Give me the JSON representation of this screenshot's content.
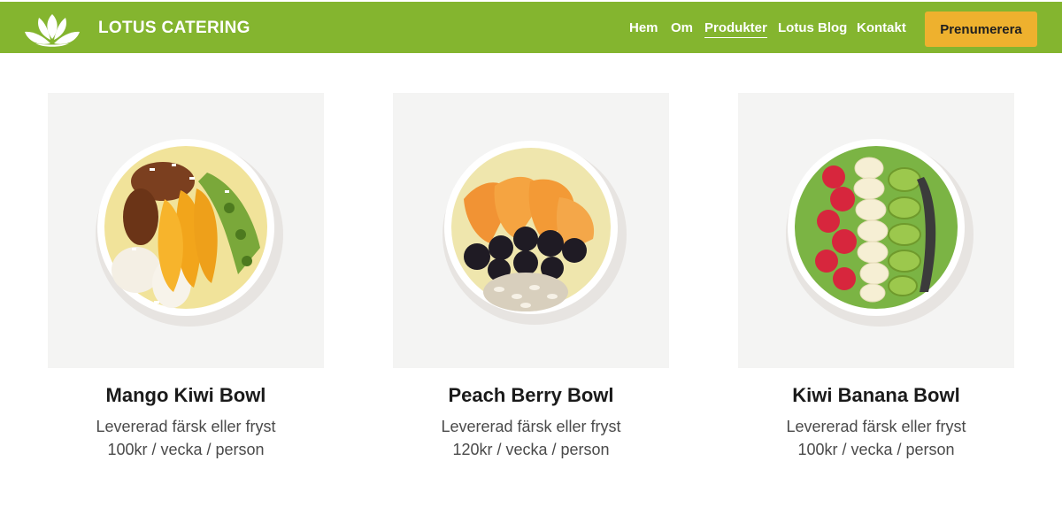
{
  "header": {
    "brand": "LOTUS CATERING",
    "logo_icon": "lotus-icon",
    "nav": [
      {
        "label": "Hem",
        "active": false
      },
      {
        "label": "Om",
        "active": false
      },
      {
        "label": "Produkter",
        "active": true
      },
      {
        "label": "Lotus Blog",
        "active": false
      },
      {
        "label": "Kontakt",
        "active": false
      }
    ],
    "cta_label": "Prenumerera"
  },
  "colors": {
    "nav_bg": "#84b52f",
    "cta_bg": "#eeb12e",
    "card_bg": "#f4f4f3"
  },
  "products": [
    {
      "name": "Mango Kiwi Bowl",
      "delivery": "Levererad färsk eller fryst",
      "price": "100kr / vecka / person",
      "image": "mango-kiwi-bowl-image"
    },
    {
      "name": "Peach Berry Bowl",
      "delivery": "Levererad färsk eller fryst",
      "price": "120kr / vecka / person",
      "image": "peach-berry-bowl-image"
    },
    {
      "name": "Kiwi Banana Bowl",
      "delivery": "Levererad färsk eller fryst",
      "price": "100kr / vecka / person",
      "image": "kiwi-banana-bowl-image"
    }
  ]
}
